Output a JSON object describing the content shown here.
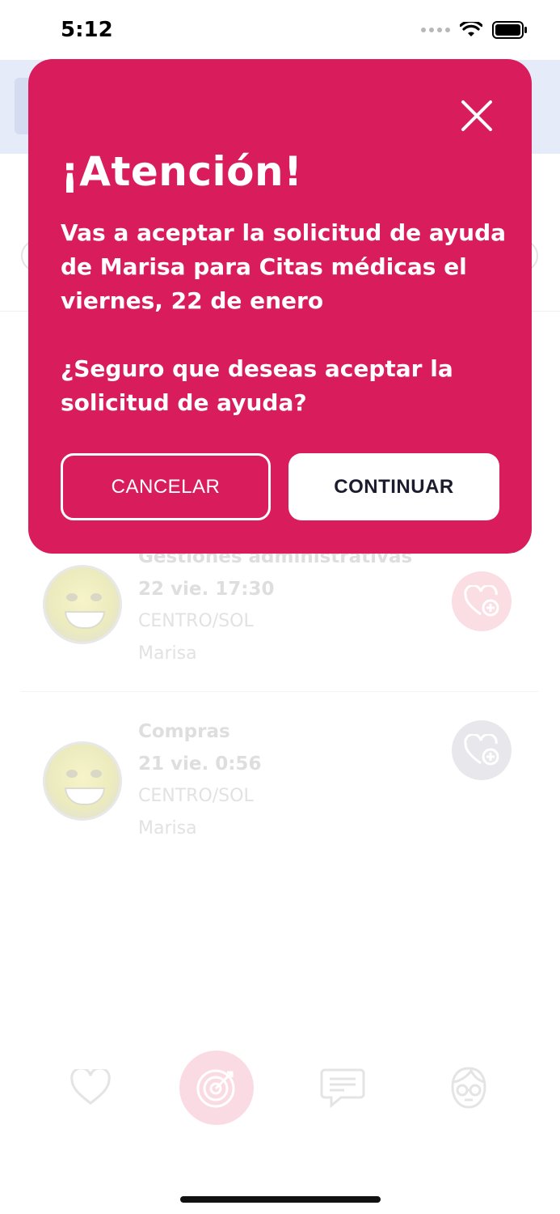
{
  "status_bar": {
    "time": "5:12"
  },
  "modal": {
    "title": "¡Atención!",
    "message": "Vas a aceptar la solicitud de ayuda de Marisa para Citas médicas el viernes, 22 de enero",
    "question": "¿Seguro que deseas aceptar la solicitud de ayuda?",
    "cancel_label": "CANCELAR",
    "continue_label": "CONTINUAR"
  },
  "requests": [
    {
      "category": "Gestiones administrativas",
      "datetime": "22 vie. 17:30",
      "zone": "CENTRO/SOL",
      "user": "Marisa"
    },
    {
      "category": "Compras",
      "datetime": "21 vie. 0:56",
      "zone": "CENTRO/SOL",
      "user": "Marisa"
    }
  ],
  "colors": {
    "modal": "#d91d5c",
    "accent_pink_faded": "#fbdde4"
  },
  "icons": {
    "tabs": [
      "heart-icon",
      "target-icon",
      "chat-icon",
      "avatar-glasses-icon"
    ],
    "request_action": "heart-plus-icon",
    "close": "close-icon"
  }
}
